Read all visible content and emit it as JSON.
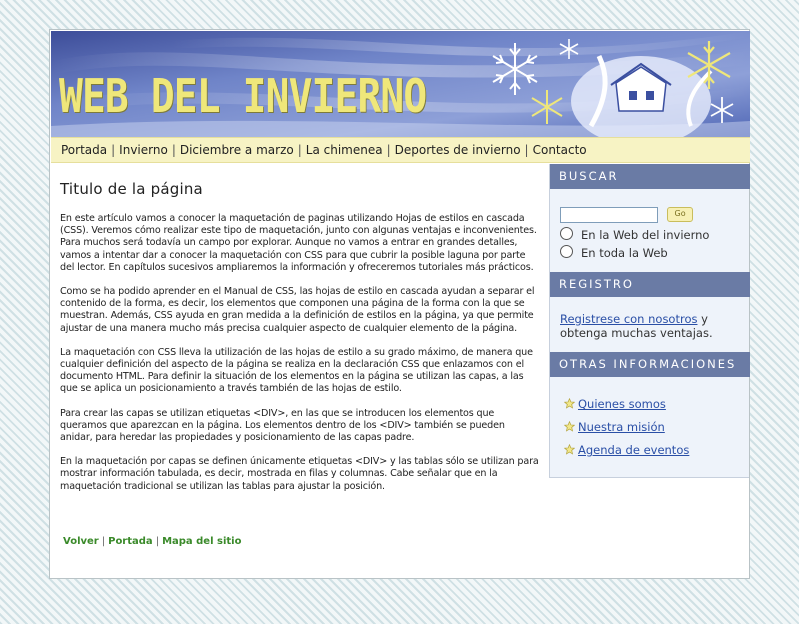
{
  "banner": {
    "logo_text": "WEB DEL INVIERNO"
  },
  "nav": {
    "items": [
      "Portada",
      "Invierno",
      "Diciembre a marzo",
      "La chimenea",
      "Deportes de invierno",
      "Contacto"
    ],
    "separator": "|"
  },
  "main": {
    "title": "Titulo de la página",
    "paragraphs": [
      "En este artículo vamos a conocer la maquetación de paginas utilizando Hojas de estilos en cascada (CSS). Veremos cómo realizar este tipo de maquetación, junto con algunas ventajas e inconvenientes. Para muchos será todavía un campo por explorar. Aunque no vamos a entrar en grandes detalles, vamos a intentar dar a conocer la maquetación con CSS para que cubrir la posible laguna por parte del lector. En capítulos sucesivos ampliaremos la información y ofrecer­emos tutoriales más prácticos.",
      "Como se ha podido aprender en el Manual de CSS, las hojas de estilo en cascada ayudan a separar el contenido de la forma, es decir, los elementos que componen una página de la forma con la que se muestran. Además, CSS ayuda en gran medida a la definición de estilos en la página, ya que permite ajustar de una manera mucho más precisa cualquier aspecto de cualquier elemento de la página.",
      "La maquetación con CSS lleva la utilización de las hojas de estilo a su grado máximo, de manera que cualquier definición del aspecto de la página se realiza en la declaración CSS que enlazamos con el documento HTML. Para definir la situación de los elementos en la página se utilizan las capas, a las que se aplica un posicionamiento a través también de las hojas de estilo.",
      "Para crear las capas se utilizan etiquetas <DIV>, en las que se introducen los elementos que queramos que aparezcan en la página. Los elementos dentro de los <DIV> también se pueden anidar, para heredar las propiedades y posicionamiento de las capas padre.",
      "En la maquetación por capas se definen únicamente etiquetas <DIV> y las tablas sólo se utilizan para mostrar información tabulada, es decir, mostrada en filas y columnas. Cabe señalar que en la maquetación tradicional se utilizan las tablas para ajustar la posición."
    ]
  },
  "footer": {
    "links": [
      "Volver",
      "Portada",
      "Mapa del sitio"
    ],
    "separator": "|"
  },
  "sidebar": {
    "search": {
      "heading": "BUSCAR",
      "input_value": "",
      "go_label": "Go",
      "options": [
        "En la Web del invierno",
        "En toda la Web"
      ]
    },
    "registro": {
      "heading": "REGISTRO",
      "link_text": "Registrese con nosotros",
      "rest_text": " y obtenga muchas ventajas."
    },
    "otras": {
      "heading": "OTRAS INFORMACIONES",
      "links": [
        "Quienes somos",
        "Nuestra misión",
        "Agenda de eventos"
      ]
    }
  },
  "colors": {
    "nav_bg": "#f7f3c4",
    "sidebar_head": "#6a7ba5",
    "sidebar_bg": "#eef3fa",
    "link_blue": "#2a4fa6",
    "footer_green": "#3a8a2a",
    "logo_yellow": "#efe77a"
  },
  "icons": [
    "snowflake-icon",
    "house-icon",
    "star-icon",
    "radio-icon"
  ]
}
